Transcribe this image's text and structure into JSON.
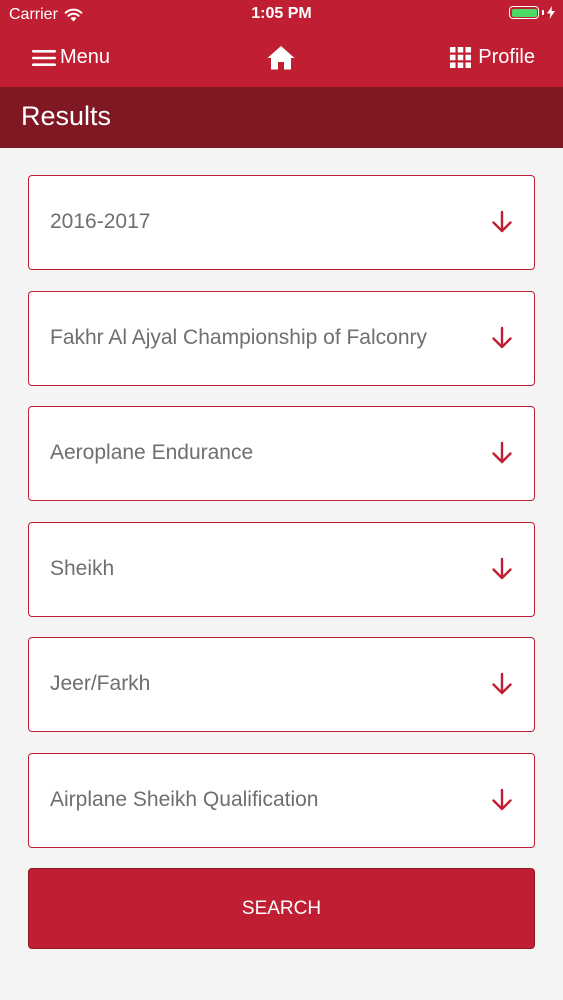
{
  "status_bar": {
    "carrier": "Carrier",
    "time": "1:05 PM"
  },
  "nav": {
    "menu_label": "Menu",
    "profile_label": "Profile",
    "home_icon": "home-icon",
    "menu_icon": "hamburger-icon",
    "profile_icon": "grid-icon"
  },
  "page": {
    "title": "Results"
  },
  "filters": [
    {
      "value": "2016-2017"
    },
    {
      "value": "Fakhr Al Ajyal Championship of Falconry"
    },
    {
      "value": "Aeroplane Endurance"
    },
    {
      "value": "Sheikh"
    },
    {
      "value": "Jeer/Farkh"
    },
    {
      "value": "Airplane Sheikh Qualification"
    }
  ],
  "search_button": {
    "label": "SEARCH"
  },
  "colors": {
    "primary": "#c01f33",
    "title_bar": "#7f1822",
    "background": "#f4f4f4",
    "select_text": "#6e6e73",
    "battery": "#4cd964"
  }
}
